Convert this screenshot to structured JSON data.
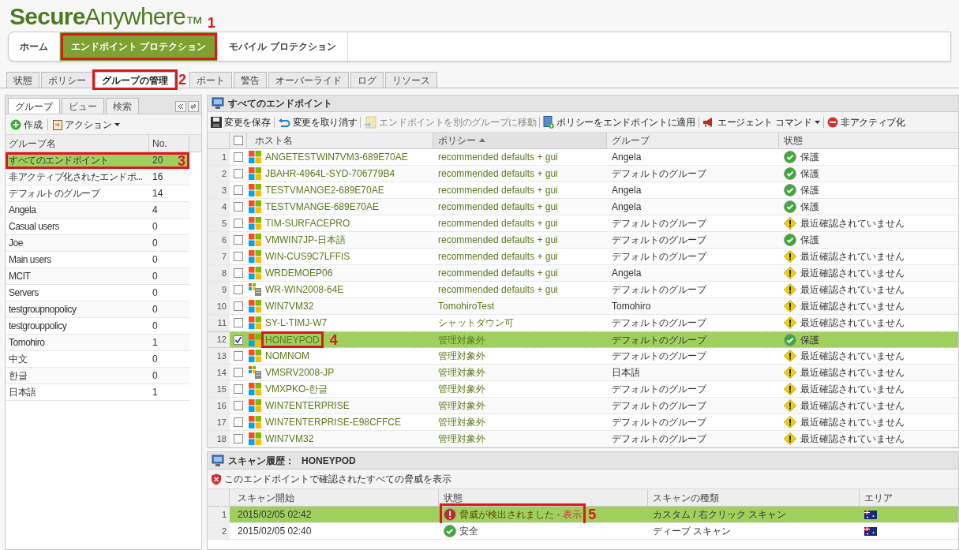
{
  "logo": "**Secure**Anywhere$_{™}$",
  "nav_tabs": [
    {
      "label": "ホーム",
      "selected": false
    },
    {
      "label": "エンドポイント プロテクション",
      "selected": true,
      "callout": "1"
    },
    {
      "label": "モバイル プロテクション",
      "selected": false
    }
  ],
  "sub_tabs": [
    {
      "label": "状態",
      "selected": false
    },
    {
      "label": "ポリシー",
      "selected": false
    },
    {
      "label": "グループの管理",
      "selected": true,
      "callout": "2"
    },
    {
      "label": "ポート",
      "selected": false
    },
    {
      "label": "警告",
      "selected": false
    },
    {
      "label": "オーバーライド",
      "selected": false
    },
    {
      "label": "ログ",
      "selected": false
    },
    {
      "label": "リソース",
      "selected": false
    }
  ],
  "left_panel": {
    "tabs": [
      {
        "label": "グループ",
        "selected": true
      },
      {
        "label": "ビュー",
        "selected": false
      },
      {
        "label": "検索",
        "selected": false
      }
    ],
    "toolbar": [
      "作成",
      "アクション"
    ],
    "columns": [
      "グループ名",
      "No."
    ],
    "groups": [
      {
        "name": "すべてのエンドポイント",
        "count": "20",
        "selected": true,
        "callout": "3"
      },
      {
        "name": "非アクティブ化されたエンドポ...",
        "count": "16",
        "selected": false
      },
      {
        "name": "デフォルトのグループ",
        "count": "14",
        "selected": false
      },
      {
        "name": "Angela",
        "count": "4",
        "selected": false
      },
      {
        "name": "Casual users",
        "count": "0",
        "selected": false
      },
      {
        "name": "Joe",
        "count": "0",
        "selected": false
      },
      {
        "name": "Main users",
        "count": "0",
        "selected": false
      },
      {
        "name": "MCIT",
        "count": "0",
        "selected": false
      },
      {
        "name": "Servers",
        "count": "0",
        "selected": false
      },
      {
        "name": "testgroupnopolicy",
        "count": "0",
        "selected": false
      },
      {
        "name": "testgrouppolicy",
        "count": "0",
        "selected": false
      },
      {
        "name": "Tomohiro",
        "count": "1",
        "selected": false
      },
      {
        "name": "中文",
        "count": "0",
        "selected": false
      },
      {
        "name": "한글",
        "count": "0",
        "selected": false
      },
      {
        "name": "日本語",
        "count": "1",
        "selected": false
      }
    ]
  },
  "endpoints": {
    "select_all": {
      "checked": false
    },
    "title": "すべてのエンドポイント",
    "toolbar": [
      {
        "label": "変更を保存",
        "kind": "save",
        "disabled": false
      },
      {
        "label": "変更を取り消す",
        "kind": "undo",
        "disabled": false
      },
      {
        "label": "エンドポイントを別のグループに移動",
        "kind": "move",
        "disabled": true
      },
      {
        "label": "ポリシーをエンドポイントに適用",
        "kind": "policy",
        "disabled": false
      },
      {
        "label": "エージェント コマンド",
        "kind": "command",
        "disabled": false
      },
      {
        "label": "非アクティブ化",
        "kind": "deactivate",
        "disabled": false
      }
    ],
    "columns": [
      "ホスト名",
      "ポリシー",
      "グループ",
      "状態"
    ],
    "rows": [
      {
        "num": "1",
        "os": {
          "kind": "windows"
        },
        "host": "ANGETESTWIN7VM3-689E70AE",
        "policy": "recommended defaults + gui",
        "group": "Angela",
        "status": {
          "text": "保護",
          "kind": "ok"
        },
        "checked": false,
        "selected": false
      },
      {
        "num": "2",
        "os": {
          "kind": "windows"
        },
        "host": "JBAHR-4964L-SYD-706779B4",
        "policy": "recommended defaults + gui",
        "group": "デフォルトのグループ",
        "status": {
          "text": "保護",
          "kind": "ok"
        },
        "checked": false,
        "selected": false
      },
      {
        "num": "3",
        "os": {
          "kind": "windows"
        },
        "host": "TESTVMANGE2-689E70AE",
        "policy": "recommended defaults + gui",
        "group": "Angela",
        "status": {
          "text": "保護",
          "kind": "ok"
        },
        "checked": false,
        "selected": false
      },
      {
        "num": "4",
        "os": {
          "kind": "windows"
        },
        "host": "TESTVMANGE-689E70AE",
        "policy": "recommended defaults + gui",
        "group": "Angela",
        "status": {
          "text": "保護",
          "kind": "ok"
        },
        "checked": false,
        "selected": false
      },
      {
        "num": "5",
        "os": {
          "kind": "windows"
        },
        "host": "TIM-SURFACEPRO",
        "policy": "recommended defaults + gui",
        "group": "デフォルトのグループ",
        "status": {
          "text": "最近確認されていません",
          "kind": "warn"
        },
        "checked": false,
        "selected": false
      },
      {
        "num": "6",
        "os": {
          "kind": "windows"
        },
        "host": "VMWIN7JP-日本語",
        "policy": "recommended defaults + gui",
        "group": "デフォルトのグループ",
        "status": {
          "text": "保護",
          "kind": "ok"
        },
        "checked": false,
        "selected": false
      },
      {
        "num": "7",
        "os": {
          "kind": "windows"
        },
        "host": "WIN-CUS9C7LFFIS",
        "policy": "recommended defaults + gui",
        "group": "デフォルトのグループ",
        "status": {
          "text": "最近確認されていません",
          "kind": "warn"
        },
        "checked": false,
        "selected": false
      },
      {
        "num": "8",
        "os": {
          "kind": "windows"
        },
        "host": "WRDEMOEP06",
        "policy": "recommended defaults + gui",
        "group": "Angela",
        "status": {
          "text": "最近確認されていません",
          "kind": "warn"
        },
        "checked": false,
        "selected": false
      },
      {
        "num": "9",
        "os": {
          "kind": "server"
        },
        "host": "WR-WIN2008-64E",
        "policy": "recommended defaults + gui",
        "group": "デフォルトのグループ",
        "status": {
          "text": "最近確認されていません",
          "kind": "warn"
        },
        "checked": false,
        "selected": false
      },
      {
        "num": "10",
        "os": {
          "kind": "windows"
        },
        "host": "WIN7VM32",
        "policy": "TomohiroTest",
        "group": "Tomohiro",
        "status": {
          "text": "最近確認されていません",
          "kind": "warn"
        },
        "checked": false,
        "selected": false
      },
      {
        "num": "11",
        "os": {
          "kind": "windows"
        },
        "host": "SY-L-TIMJ-W7",
        "policy": "シャットダウン可",
        "group": "デフォルトのグループ",
        "status": {
          "text": "最近確認されていません",
          "kind": "warn"
        },
        "checked": false,
        "selected": false
      },
      {
        "num": "12",
        "os": {
          "kind": "windows"
        },
        "host": "HONEYPOD",
        "policy": "管理対象外",
        "group": "デフォルトのグループ",
        "status": {
          "text": "保護",
          "kind": "ok"
        },
        "checked": true,
        "selected": true,
        "callout": "4"
      },
      {
        "num": "13",
        "os": {
          "kind": "windows"
        },
        "host": "NOMNOM",
        "policy": "管理対象外",
        "group": "デフォルトのグループ",
        "status": {
          "text": "最近確認されていません",
          "kind": "warn"
        },
        "checked": false,
        "selected": false
      },
      {
        "num": "14",
        "os": {
          "kind": "server"
        },
        "host": "VMSRV2008-JP",
        "policy": "管理対象外",
        "group": "日本語",
        "status": {
          "text": "最近確認されていません",
          "kind": "warn"
        },
        "checked": false,
        "selected": false
      },
      {
        "num": "15",
        "os": {
          "kind": "windows"
        },
        "host": "VMXPKO-한글",
        "policy": "管理対象外",
        "group": "デフォルトのグループ",
        "status": {
          "text": "最近確認されていません",
          "kind": "warn"
        },
        "checked": false,
        "selected": false
      },
      {
        "num": "16",
        "os": {
          "kind": "windows"
        },
        "host": "WIN7ENTERPRISE",
        "policy": "管理対象外",
        "group": "デフォルトのグループ",
        "status": {
          "text": "最近確認されていません",
          "kind": "warn"
        },
        "checked": false,
        "selected": false
      },
      {
        "num": "17",
        "os": {
          "kind": "windows"
        },
        "host": "WIN7ENTERPRISE-E98CFFCE",
        "policy": "管理対象外",
        "group": "デフォルトのグループ",
        "status": {
          "text": "最近確認されていません",
          "kind": "warn"
        },
        "checked": false,
        "selected": false
      },
      {
        "num": "18",
        "os": {
          "kind": "windows"
        },
        "host": "WIN7VM32",
        "policy": "管理対象外",
        "group": "デフォルトのグループ",
        "status": {
          "text": "最近確認されていません",
          "kind": "warn"
        },
        "checked": false,
        "selected": false
      }
    ]
  },
  "scan_history": {
    "title": "スキャン履歴：",
    "host": "HONEYPOD",
    "toolbar": "このエンドポイントで確認されたすべての脅威を表示",
    "columns": [
      "スキャン開始",
      "状態",
      "スキャンの種類",
      "エリア"
    ],
    "rows": [
      {
        "num": "1",
        "start": "2015/02/05 02:42",
        "status": {
          "text": "脅威が検出されました -",
          "kind": "threat"
        },
        "link": "表示",
        "type": "カスタム / 右クリック スキャン",
        "selected": true,
        "callout": "5"
      },
      {
        "num": "2",
        "start": "2015/02/05 02:40",
        "status": {
          "text": "安全",
          "kind": "ok"
        },
        "type": "ディープ スキャン",
        "selected": false
      }
    ]
  }
}
